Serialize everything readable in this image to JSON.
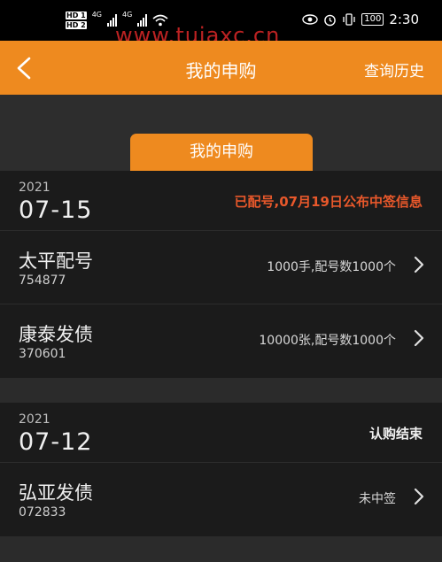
{
  "status_bar": {
    "hd1": "HD 1",
    "hd2": "HD 2",
    "net1": "4G",
    "net2": "4G",
    "battery": "100",
    "time": "2:30"
  },
  "watermark": "www.tuiaxc.cn",
  "nav": {
    "title": "我的申购",
    "right_action": "查询历史"
  },
  "tab": {
    "label": "我的申购"
  },
  "groups": [
    {
      "year": "2021",
      "date": "07-15",
      "status": "已配号,07月19日公布中签信息",
      "status_color": "#e8582b",
      "items": [
        {
          "name": "太平配号",
          "code": "754877",
          "info": "1000手,配号数1000个"
        },
        {
          "name": "康泰发债",
          "code": "370601",
          "info": "10000张,配号数1000个"
        }
      ]
    },
    {
      "year": "2021",
      "date": "07-12",
      "status": "认购结束",
      "status_color": "#f0f0f0",
      "items": [
        {
          "name": "弘亚发债",
          "code": "072833",
          "info": "未中签"
        }
      ]
    }
  ],
  "colors": {
    "accent": "#ee8a1f",
    "background": "#2b2b2b",
    "card": "#1b1b1b"
  }
}
